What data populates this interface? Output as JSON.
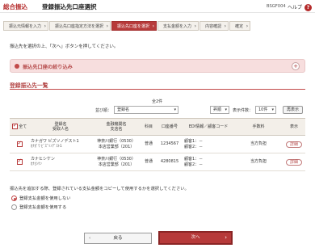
{
  "header": {
    "logo": "総合振込",
    "title": "登録振込先口座選択",
    "screen_id": "BSGF004",
    "help_label": "ヘルプ",
    "help_icon": "?"
  },
  "steps": [
    {
      "label": "振込元情報を入力",
      "active": false
    },
    {
      "label": "振込先口座指定方法を選択",
      "active": false
    },
    {
      "label": "振込先口座を選択",
      "active": true
    },
    {
      "label": "支払金額を入力",
      "active": false
    },
    {
      "label": "内容確認",
      "active": false
    },
    {
      "label": "確定",
      "active": false
    }
  ],
  "instruction": "振込先を選択の上、「次へ」ボタンを押してください。",
  "filter": {
    "label": "振込先口座の絞り込み",
    "toggle": "+"
  },
  "list": {
    "title": "登録振込先一覧",
    "count": "全2件",
    "sort_label": "並び順：",
    "sort_value": "登録名",
    "order_value": "昇順",
    "per_page_label": "表示件数：",
    "per_page_value": "10件",
    "redisplay": "再表示",
    "columns": {
      "all": "全て",
      "name_line1": "登録名",
      "name_line2": "受取人名",
      "bank_line1": "金融機関名",
      "bank_line2": "支店名",
      "type": "科目",
      "account": "口座番号",
      "edi": "EDI情報／顧客コード",
      "fee": "手数料",
      "show": "表示"
    },
    "rows": [
      {
        "registered": "カナガワ ビズソノデスト1",
        "payee": "ｶﾅｶﾞﾜ ﾋﾞｽﾞｿﾉﾃﾞｽﾄ1",
        "bank": "神奈川銀行（0530）",
        "branch": "本店営業部（201）",
        "type": "普通",
        "account": "1234567",
        "edi1": "顧客1：－",
        "edi2": "顧客2：－",
        "fee": "当方負担",
        "detail": "詳細"
      },
      {
        "registered": "カナヒシケン",
        "payee": "ｶﾅﾋｼｹﾝ",
        "bank": "神奈川銀行（0530）",
        "branch": "本店営業部（201）",
        "type": "普通",
        "account": "4280815",
        "edi1": "顧客1：－",
        "edi2": "顧客2：－",
        "fee": "当方負担",
        "detail": "詳細"
      }
    ]
  },
  "copy_note": "振込先を追加する際、登録されている支払金額をコピーして使用するかを選択してください。",
  "radio_options": [
    "登録支払金額を使用しない",
    "登録支払金額を使用する"
  ],
  "buttons": {
    "back": "戻る",
    "next": "次へ"
  },
  "colors": {
    "accent": "#b73a3a",
    "step_bg": "#f4f1ec",
    "filter_bg": "#f7dede"
  }
}
